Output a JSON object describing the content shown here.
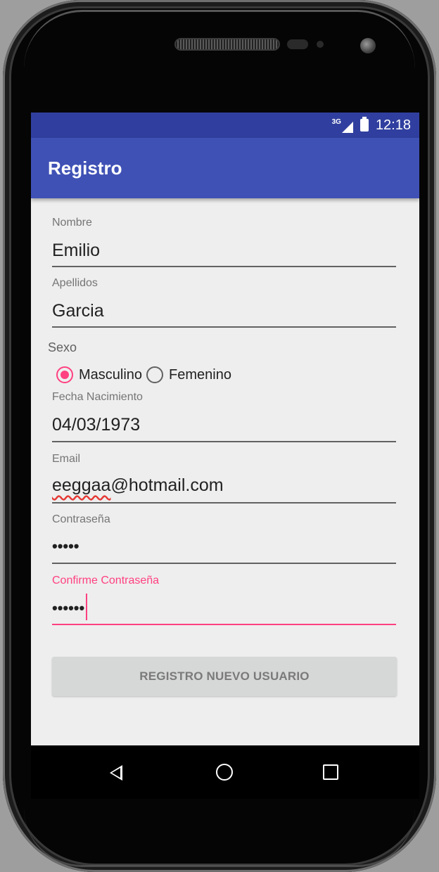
{
  "status_bar": {
    "network": "3G",
    "time": "12:18"
  },
  "app_bar": {
    "title": "Registro"
  },
  "form": {
    "nombre": {
      "label": "Nombre",
      "value": "Emilio"
    },
    "apellidos": {
      "label": "Apellidos",
      "value": "Garcia"
    },
    "sexo": {
      "label": "Sexo",
      "options": [
        {
          "label": "Masculino",
          "checked": true
        },
        {
          "label": "Femenino",
          "checked": false
        }
      ]
    },
    "fecha": {
      "label": "Fecha Nacimiento",
      "value": "04/03/1973"
    },
    "email": {
      "label": "Email",
      "value_misspelled": "eeggaa",
      "value_rest": "@hotmail.com"
    },
    "password": {
      "label": "Contraseña",
      "value": "•••••"
    },
    "confirm": {
      "label": "Confirme Contraseña",
      "value": "••••••",
      "accent": "#ff4081"
    },
    "submit": {
      "label": "REGISTRO NUEVO USUARIO"
    }
  },
  "nav": {
    "back": "back-icon",
    "home": "home-icon",
    "recent": "recent-apps-icon"
  },
  "colors": {
    "primary": "#3f51b5",
    "primary_dark": "#303f9f",
    "accent": "#ff4081",
    "background": "#eeeeee"
  }
}
